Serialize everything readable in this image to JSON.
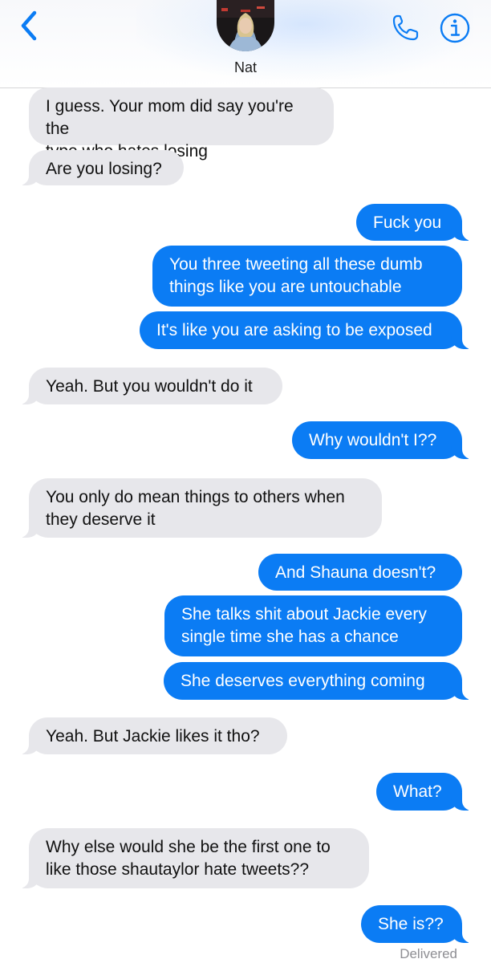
{
  "header": {
    "contact_name": "Nat",
    "accent_color": "#0b7cf4",
    "back_icon": "chevron-left-icon",
    "call_icon": "phone-icon",
    "info_icon": "info-icon"
  },
  "messages": [
    {
      "side": "received",
      "text": "I guess. Your mom did say you're the\ntype who hates losing"
    },
    {
      "side": "received",
      "text": "Are you losing?"
    },
    {
      "side": "sent",
      "text": "Fuck you"
    },
    {
      "side": "sent",
      "text": "You three tweeting all these dumb\nthings like you are untouchable"
    },
    {
      "side": "sent",
      "text": "It's like you are asking to be exposed"
    },
    {
      "side": "received",
      "text": "Yeah. But you wouldn't do it"
    },
    {
      "side": "sent",
      "text": "Why wouldn't I??"
    },
    {
      "side": "received",
      "text": "You only do mean things to others when\nthey deserve it"
    },
    {
      "side": "sent",
      "text": "And Shauna doesn't?"
    },
    {
      "side": "sent",
      "text": "She talks shit about Jackie every\nsingle time she has a chance"
    },
    {
      "side": "sent",
      "text": "She deserves everything coming"
    },
    {
      "side": "received",
      "text": "Yeah. But Jackie likes it tho?"
    },
    {
      "side": "sent",
      "text": "What?"
    },
    {
      "side": "received",
      "text": "Why else would she be the first one to\nlike those shautaylor hate tweets??"
    },
    {
      "side": "sent",
      "text": "She is??"
    }
  ],
  "status": {
    "delivered": "Delivered"
  }
}
